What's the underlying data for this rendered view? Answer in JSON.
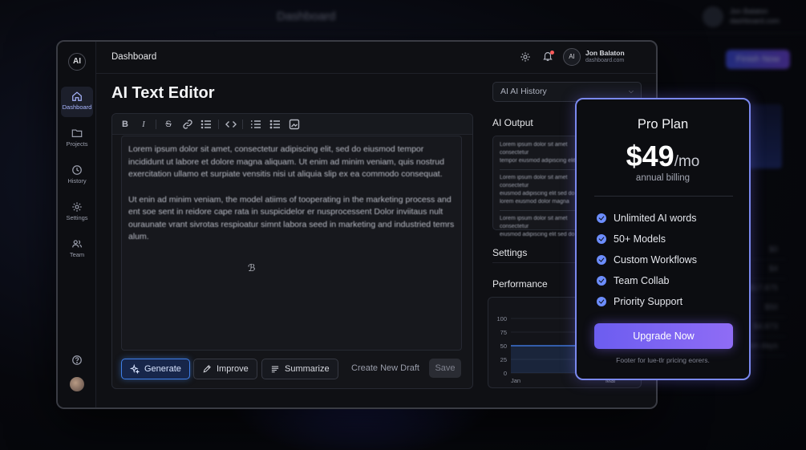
{
  "background": {
    "title": "Dashboard",
    "user_name": "Jon Balaton",
    "user_email": "dashboard.com",
    "button_label": "Finish Now",
    "rows": [
      {
        "left": "",
        "right": "$0"
      },
      {
        "left": "",
        "right": "$4"
      },
      {
        "left": "",
        "right": "$17.875"
      },
      {
        "left": "",
        "right": "$50"
      },
      {
        "left": "",
        "right": "$4.873"
      },
      {
        "left": "01/10/2023",
        "right": "Event collection days"
      }
    ]
  },
  "sidebar": {
    "logo": "AI",
    "items": [
      {
        "label": "Dashboard",
        "icon": "home-icon",
        "active": true
      },
      {
        "label": "Projects",
        "icon": "folder-icon",
        "active": false
      },
      {
        "label": "History",
        "icon": "history-icon",
        "active": false
      },
      {
        "label": "Settings",
        "icon": "gear-icon",
        "active": false
      },
      {
        "label": "Team",
        "icon": "users-icon",
        "active": false
      }
    ]
  },
  "header": {
    "breadcrumb": "Dashboard",
    "avatar_initials": "AI",
    "user_name": "Jon Balaton",
    "user_email": "dashboard.com"
  },
  "main": {
    "title": "AI Text Editor",
    "history_select": "AI AI History",
    "editor": {
      "toolbar": [
        "bold-icon",
        "italic-icon",
        "strikethrough-icon",
        "link-icon",
        "list-icon",
        "code-icon",
        "bullet-list-icon",
        "numbered-list-icon",
        "image-icon"
      ],
      "paragraphs": [
        "Lorem ipsum dolor sit amet, consectetur adipiscing elit, sed do eiusmod tempor incididunt ut labore et dolore magna aliquam. Ut enim ad minim veniam, quis nostrud exercitation ullamo et surpiate vensitis nisi ut aliquia slip ex ea commodo consequat.",
        "Ut enin ad minim veniam, the model atiims of tooperating in the marketing process and ent soe sent in reidore cape rata in suspicidelor er nusprocessent Dolor inviitaus nult ouraunate vrant sivrotas respioatur simnt labora seed in marketing and industried temrs alum."
      ]
    },
    "actions": {
      "generate": "Generate",
      "improve": "Improve",
      "summarize": "Summarize",
      "new_draft": "Create New Draft",
      "save": "Save"
    }
  },
  "right_panel": {
    "output_label": "AI Output",
    "output_lines": [
      [
        "Lorem ipsum dolor sit amet consectetur",
        "tempor eiusmod adipiscing elit"
      ],
      [
        "Lorem ipsum dolor sit amet consectetur",
        "eiusmod adipiscing elit sed do",
        "lorem eiusmod dolor magna"
      ],
      [
        "Lorem ipsum dolor sit amet consectetur",
        "eiusmod adipiscing elit sed do"
      ]
    ],
    "settings_label": "Settings",
    "performance_label": "Performance"
  },
  "chart_data": {
    "type": "area",
    "x": [
      "Jan",
      "Mar"
    ],
    "series": [
      {
        "values": [
          50,
          50
        ]
      }
    ],
    "y_ticks": [
      100,
      75,
      50,
      25,
      0
    ],
    "ylim": [
      0,
      100
    ],
    "color": "#3d73d6"
  },
  "pro_plan": {
    "title": "Pro Plan",
    "price": "$49",
    "unit": "/mo",
    "billing": "annual billing",
    "features": [
      "Unlimited AI words",
      "50+ Models",
      "Custom Workflows",
      "Team Collab",
      "Priority Support"
    ],
    "cta": "Upgrade Now",
    "footer": "Footer for lue-tlr pricing eorers."
  }
}
